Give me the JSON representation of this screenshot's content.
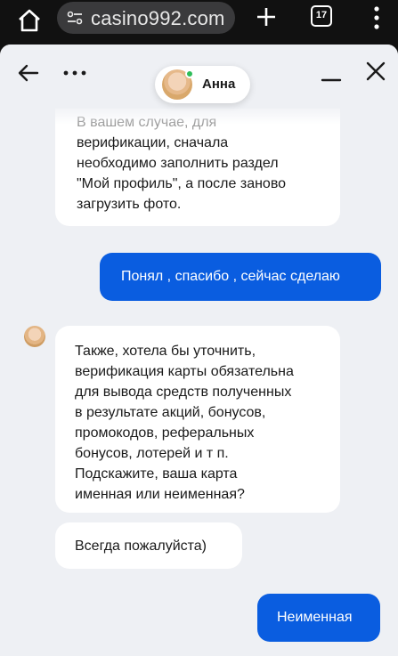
{
  "browser": {
    "url": "casino992.com",
    "tab_count": "17"
  },
  "chat": {
    "agent_name": "Анна",
    "messages": [
      {
        "from": "agent",
        "lines": [
          "В вашем случае, для",
          "верификации, сначала",
          "необходимо заполнить раздел",
          "\"Мой профиль\", а после заново",
          "загрузить фото."
        ]
      },
      {
        "from": "user",
        "lines": [
          "Понял , спасибо , сейчас сделаю"
        ]
      },
      {
        "from": "agent",
        "lines": [
          "Также, хотела бы уточнить,",
          "верификация карты обязательна",
          "для вывода средств полученных",
          "в результате акций, бонусов,",
          "промокодов, реферальных",
          "бонусов, лотерей и т п.",
          "Подскажите, ваша карта",
          "именная или неименная?"
        ]
      },
      {
        "from": "agent",
        "lines": [
          "Всегда пожалуйста)"
        ]
      },
      {
        "from": "user",
        "lines": [
          "Неименная"
        ]
      }
    ]
  },
  "colors": {
    "accent": "#0a5de0",
    "online": "#2ebd59",
    "chat_bg": "#eef0f4"
  }
}
